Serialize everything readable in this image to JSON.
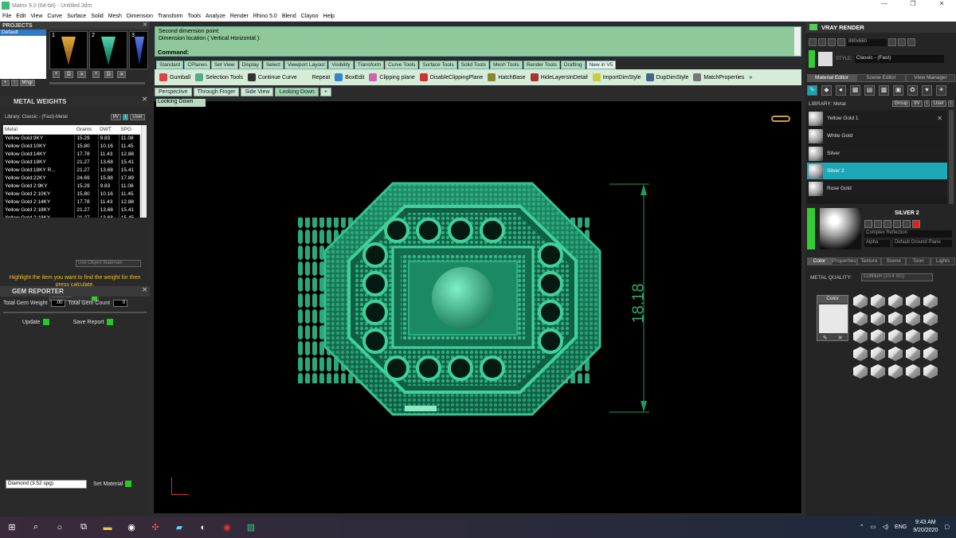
{
  "window": {
    "title": "Matrix 9.0 (64-bit) - Untitled.3dm",
    "min": "—",
    "max": "❐",
    "close": "✕"
  },
  "menu": [
    "File",
    "Edit",
    "View",
    "Curve",
    "Surface",
    "Solid",
    "Mesh",
    "Dimension",
    "Transform",
    "Tools",
    "Analyze",
    "Render",
    "Rhino 5.0",
    "Blend",
    "Clayoo",
    "Help"
  ],
  "projects": {
    "title": "PROJECTS",
    "selected": "Default",
    "thumbs": [
      "1",
      "2",
      "3"
    ],
    "tools": [
      "+",
      "↑",
      "Mngr"
    ]
  },
  "metal": {
    "title": "METAL WEIGHTS",
    "library": "Library: Classic - (Fast)-Metal",
    "btn1": "9V",
    "btn2": "i",
    "btn3": "User",
    "headers": [
      "Metal",
      "Grams",
      "DWT",
      "SPG"
    ],
    "rows": [
      [
        "Yellow Gold:9KY",
        "15.29",
        "9.83",
        "11.08"
      ],
      [
        "Yellow Gold:10KY",
        "15.80",
        "10.16",
        "11.45"
      ],
      [
        "Yellow Gold:14KY",
        "17.78",
        "11.43",
        "12.88"
      ],
      [
        "Yellow Gold:18KY",
        "21.27",
        "13.68",
        "15.41"
      ],
      [
        "Yellow Gold:18KY R...",
        "21.27",
        "13.68",
        "15.41"
      ],
      [
        "Yellow Gold:22KY",
        "24.69",
        "15.88",
        "17.89"
      ],
      [
        "Yellow Gold 2:9KY",
        "15.29",
        "9.83",
        "11.08"
      ],
      [
        "Yellow Gold 2:10KY",
        "15.80",
        "10.16",
        "11.45"
      ],
      [
        "Yellow Gold 2:14KY",
        "17.78",
        "11.43",
        "12.88"
      ],
      [
        "Yellow Gold 2:18KY",
        "21.27",
        "13.68",
        "15.41"
      ],
      [
        "Yellow Gold 2:18KY...",
        "21.27",
        "13.68",
        "15.45"
      ]
    ],
    "use_object": "Use Object Materials",
    "hint": "Highlight the item you want to find the weight for then press calculate.",
    "calculate": "Calculate"
  },
  "gem": {
    "title": "GEM REPORTER",
    "total_weight_label": "Total Gem Weight",
    "total_weight": ".00",
    "total_count_label": "Total Gem Count",
    "total_count": "0",
    "update": "Update",
    "save": "Save Report"
  },
  "bottom": {
    "select": "Diamond     (3.52 spg)",
    "set_material": "Set Material"
  },
  "command": {
    "line1": "Second dimension point:",
    "line2": "Dimension location ( Vertical  Horizontal ):",
    "prompt": "Command:"
  },
  "tabs": [
    "Standard",
    "CPlanes",
    "Set View",
    "Display",
    "Select",
    "Viewport Layout",
    "Visibility",
    "Transform",
    "Curve Tools",
    "Surface Tools",
    "Solid Tools",
    "Mesh Tools",
    "Render Tools",
    "Drafting",
    "New in V5"
  ],
  "toolbar": [
    {
      "label": "Gumball",
      "c": "#d44"
    },
    {
      "label": "Selection Tools",
      "c": "#5a8"
    },
    {
      "label": "Continue Curve",
      "c": "#333"
    },
    {
      "label": "Repeat",
      "c": "#d5ecd8"
    },
    {
      "label": "BoxEdit",
      "c": "#38c"
    },
    {
      "label": "Clipping plane",
      "c": "#c6a"
    },
    {
      "label": "DisableClippingPlane",
      "c": "#c33"
    },
    {
      "label": "HatchBase",
      "c": "#883"
    },
    {
      "label": "HideLayersInDetail",
      "c": "#a33"
    },
    {
      "label": "ImportDimStyle",
      "c": "#cc4"
    },
    {
      "label": "DupDimStyle",
      "c": "#468"
    },
    {
      "label": "MatchProperties",
      "c": "#777"
    }
  ],
  "toolbar_more": "»",
  "viewtabs": [
    "Perspective",
    "Through Finger",
    "Side View",
    "Looking Down",
    "+"
  ],
  "viewport": {
    "label": "Looking Down",
    "dimension": "18.18"
  },
  "vray": {
    "title": "VRAY RENDER",
    "resolution": "880x660",
    "style_label": "STYLE:",
    "style": "Classic - (Fast)",
    "tabs": [
      "Material Editor",
      "Scene Editor",
      "View Manager"
    ],
    "library": "LIBRARY: Metal",
    "lib_btns": [
      "Group",
      "9V",
      "i",
      "User",
      "i"
    ],
    "materials": [
      "Yellow Gold 1",
      "White Gold",
      "Silver",
      "Silver 2",
      "Rose Gold"
    ],
    "selected_name": "SILVER 2",
    "reflection": "Complex Reflection",
    "alpha": "Alpha",
    "ground": "Default Ground Plane",
    "bottom_tabs": [
      "Color",
      "Properties",
      "Texture",
      "Scene",
      "Toon",
      "Lights"
    ],
    "quality_label": "METAL QUALITY:",
    "quality": "Cottilium        (10.4 SG)",
    "color_label": "Color"
  },
  "taskbar": {
    "time": "9:43 AM",
    "date": "9/20/2020",
    "lang": "ENG"
  }
}
